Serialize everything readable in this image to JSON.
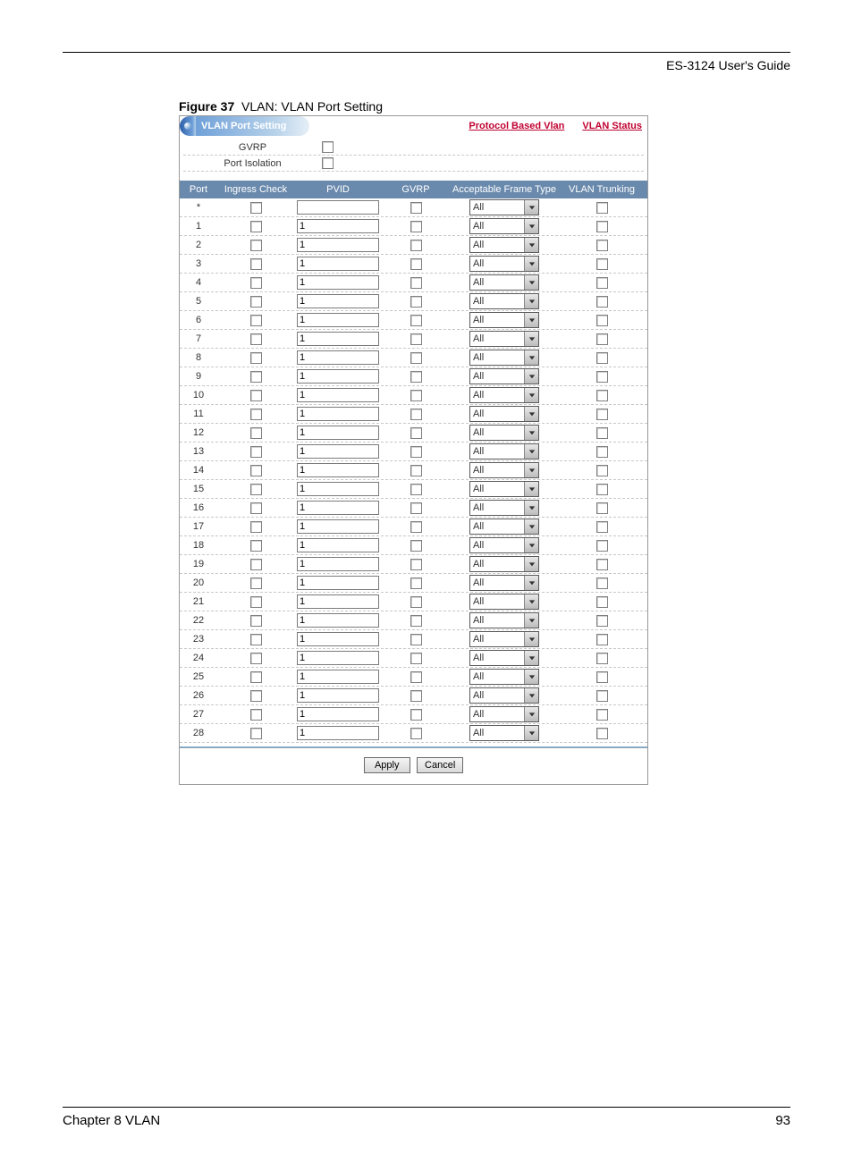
{
  "doc": {
    "header_guide": "ES-3124 User's Guide",
    "figure_label": "Figure 37",
    "figure_title": "VLAN: VLAN Port Setting",
    "chapter": "Chapter 8 VLAN",
    "page_number": "93"
  },
  "window": {
    "tab_title": "VLAN Port Setting",
    "link_protocol": "Protocol Based Vlan",
    "link_status": "VLAN Status"
  },
  "global": {
    "gvrp_label": "GVRP",
    "port_isolation_label": "Port Isolation"
  },
  "columns": {
    "port": "Port",
    "ingress": "Ingress Check",
    "pvid": "PVID",
    "gvrp": "GVRP",
    "frame_type": "Acceptable Frame Type",
    "trunking": "VLAN Trunking"
  },
  "buttons": {
    "apply": "Apply",
    "cancel": "Cancel"
  },
  "frame_value": "All",
  "rows": [
    {
      "port": "*",
      "pvid": ""
    },
    {
      "port": "1",
      "pvid": "1"
    },
    {
      "port": "2",
      "pvid": "1"
    },
    {
      "port": "3",
      "pvid": "1"
    },
    {
      "port": "4",
      "pvid": "1"
    },
    {
      "port": "5",
      "pvid": "1"
    },
    {
      "port": "6",
      "pvid": "1"
    },
    {
      "port": "7",
      "pvid": "1"
    },
    {
      "port": "8",
      "pvid": "1"
    },
    {
      "port": "9",
      "pvid": "1"
    },
    {
      "port": "10",
      "pvid": "1"
    },
    {
      "port": "11",
      "pvid": "1"
    },
    {
      "port": "12",
      "pvid": "1"
    },
    {
      "port": "13",
      "pvid": "1"
    },
    {
      "port": "14",
      "pvid": "1"
    },
    {
      "port": "15",
      "pvid": "1"
    },
    {
      "port": "16",
      "pvid": "1"
    },
    {
      "port": "17",
      "pvid": "1"
    },
    {
      "port": "18",
      "pvid": "1"
    },
    {
      "port": "19",
      "pvid": "1"
    },
    {
      "port": "20",
      "pvid": "1"
    },
    {
      "port": "21",
      "pvid": "1"
    },
    {
      "port": "22",
      "pvid": "1"
    },
    {
      "port": "23",
      "pvid": "1"
    },
    {
      "port": "24",
      "pvid": "1"
    },
    {
      "port": "25",
      "pvid": "1"
    },
    {
      "port": "26",
      "pvid": "1"
    },
    {
      "port": "27",
      "pvid": "1"
    },
    {
      "port": "28",
      "pvid": "1"
    }
  ]
}
